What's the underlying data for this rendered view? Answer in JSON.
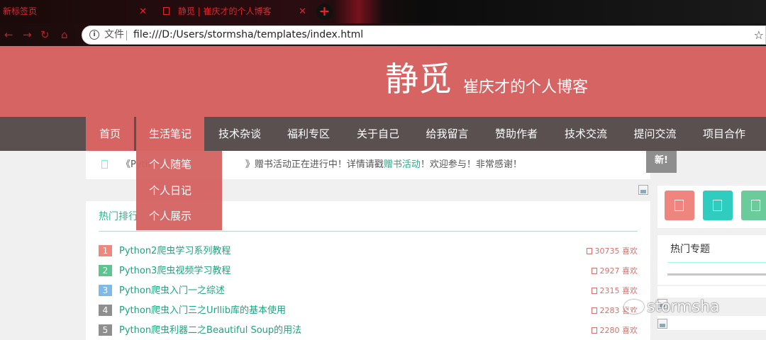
{
  "browser": {
    "tabs": [
      {
        "title": "新标签页"
      },
      {
        "title": "静觅 | 崔庆才的个人博客"
      }
    ],
    "new_tab_icon": "plus-icon",
    "address": {
      "scheme_label": "文件",
      "url": "file:///D:/Users/stormsha/templates/index.html"
    }
  },
  "site": {
    "brand": "静觅",
    "subtitle": "崔庆才的个人博客",
    "nav": [
      {
        "label": "首页"
      },
      {
        "label": "生活笔记"
      },
      {
        "label": "技术杂谈"
      },
      {
        "label": "福利专区"
      },
      {
        "label": "关于自己"
      },
      {
        "label": "给我留言"
      },
      {
        "label": "赞助作者"
      },
      {
        "label": "技术交流"
      },
      {
        "label": "提问交流"
      },
      {
        "label": "项目合作"
      }
    ],
    "dropdown": [
      {
        "label": "个人随笔"
      },
      {
        "label": "个人日记"
      },
      {
        "label": "个人展示"
      }
    ]
  },
  "notice": {
    "prefix": "《Pyth",
    "hidden_part": "…",
    "middle": "》赠书活动正在进行中！详情请戳",
    "link": "赠书活动",
    "suffix": "！欢迎参与！非常感谢！",
    "badge": "新!"
  },
  "hot": {
    "title": "热门排行",
    "items": [
      {
        "rank": "1",
        "title": "Python2爬虫学习系列教程",
        "likes": "30735 喜欢",
        "color": "#f0877f"
      },
      {
        "rank": "2",
        "title": "Python3爬虫视频学习教程",
        "likes": "2927 喜欢",
        "color": "#5bc48f"
      },
      {
        "rank": "3",
        "title": "Python爬虫入门一之综述",
        "likes": "2315 喜欢",
        "color": "#7fb9ea"
      },
      {
        "rank": "4",
        "title": "Python爬虫入门三之Urllib库的基本使用",
        "likes": "2283 喜欢",
        "color": "#8f8f8f"
      },
      {
        "rank": "5",
        "title": "Python爬虫利器二之Beautiful Soup的用法",
        "likes": "2280 喜欢",
        "color": "#8f8f8f"
      }
    ]
  },
  "sidebar": {
    "icons": [
      {
        "color": "#f0857f"
      },
      {
        "color": "#2ecdc0"
      },
      {
        "color": "#6ccb9b"
      }
    ],
    "topics_title": "热门专题"
  },
  "watermark": "stormsha"
}
